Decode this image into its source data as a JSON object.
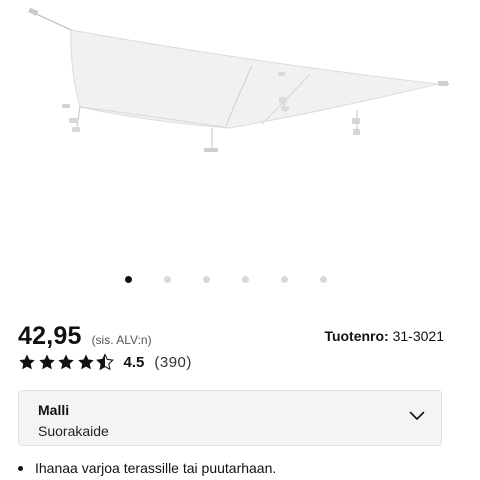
{
  "product": {
    "image_icon": "shade-sail-image",
    "carousel": {
      "count": 6,
      "active_index": 0
    },
    "price": "42,95",
    "vat_note": "(sis. ALV:n)",
    "product_number_label": "Tuotenro:",
    "product_number_value": "31-3021",
    "rating": {
      "value": "4.5",
      "count": "(390)",
      "stars": 4.5,
      "max_stars": 5
    },
    "variant": {
      "label": "Malli",
      "value": "Suorakaide",
      "icon": "chevron-down-icon"
    },
    "features": [
      "Ihanaa varjoa terassille tai puutarhaan."
    ]
  },
  "colors": {
    "text": "#111111",
    "dot_inactive": "#d9d9d9",
    "panel_bg": "#f4f4f4"
  }
}
